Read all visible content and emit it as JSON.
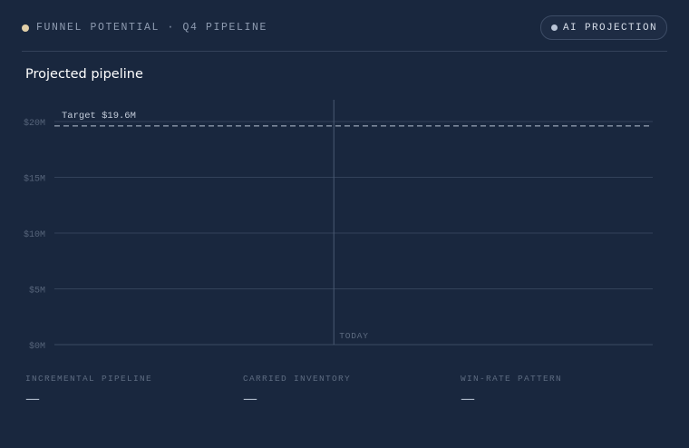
{
  "header": {
    "kicker": "FUNNEL POTENTIAL · Q4 PIPELINE",
    "badge_label": "AI PROJECTION"
  },
  "title": "Projected pipeline",
  "colors": {
    "background": "#19273e",
    "status_dot": "#e1cfa8",
    "gridline": "#33425a",
    "target_line": "#b8c2d2",
    "today_line": "#4a5a73"
  },
  "chart_data": {
    "type": "line",
    "title": "Projected pipeline",
    "xlabel": "",
    "ylabel": "",
    "ylim": [
      0,
      20
    ],
    "y_unit": "$M",
    "y_ticks": [
      {
        "value": 0,
        "label": "$0M"
      },
      {
        "value": 5,
        "label": "$5M"
      },
      {
        "value": 10,
        "label": "$10M"
      },
      {
        "value": 15,
        "label": "$15M"
      },
      {
        "value": 20,
        "label": "$20M"
      }
    ],
    "grid": true,
    "series": [],
    "reference_lines": [
      {
        "kind": "horizontal",
        "style": "dashed",
        "value": 19.6,
        "label": "Target $19.6M"
      },
      {
        "kind": "vertical",
        "style": "solid",
        "position": 0.467,
        "label": "TODAY"
      }
    ]
  },
  "metrics": [
    {
      "label": "INCREMENTAL PIPELINE",
      "value": "—"
    },
    {
      "label": "CARRIED INVENTORY",
      "value": "—"
    },
    {
      "label": "WIN-RATE PATTERN",
      "value": "—"
    }
  ]
}
